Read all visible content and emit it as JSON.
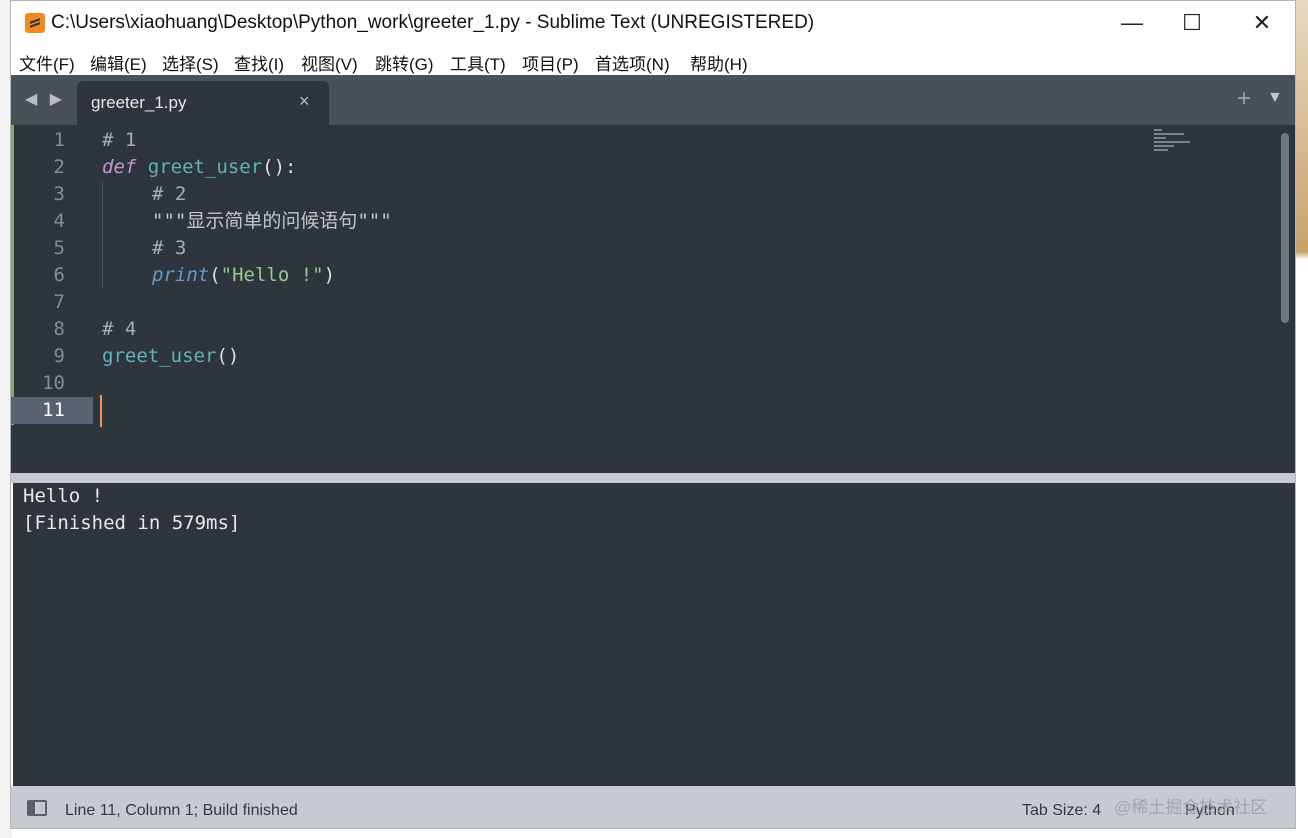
{
  "window": {
    "title": "C:\\Users\\xiaohuang\\Desktop\\Python_work\\greeter_1.py - Sublime Text (UNREGISTERED)",
    "controls": {
      "minimize": "—",
      "maximize": "☐",
      "close": "✕"
    }
  },
  "menu": [
    "文件(F)",
    "编辑(E)",
    "选择(S)",
    "查找(I)",
    "视图(V)",
    "跳转(G)",
    "工具(T)",
    "项目(P)",
    "首选项(N)",
    "帮助(H)"
  ],
  "tabs": {
    "nav": "◀ ▶",
    "active": {
      "label": "greeter_1.py",
      "close": "×"
    },
    "new_tab": "+",
    "menu": "▼"
  },
  "editor": {
    "line_numbers": [
      "1",
      "2",
      "3",
      "4",
      "5",
      "6",
      "7",
      "8",
      "9",
      "10",
      "11"
    ],
    "current_line": 11,
    "code": {
      "l1": "# 1",
      "l2_kw": "def",
      "l2_fn": "greet_user",
      "l2_rest": "():",
      "l3": "# 2",
      "l4": "\"\"\"显示简单的问候语句\"\"\"",
      "l5": "# 3",
      "l6_fn": "print",
      "l6_open": "(",
      "l6_str": "\"Hello !\"",
      "l6_close": ")",
      "l8": "# 4",
      "l9_fn": "greet_user",
      "l9_rest": "()"
    }
  },
  "output": {
    "lines": [
      "Hello !",
      "[Finished in 579ms]"
    ]
  },
  "status": {
    "position": "Line 11, Column 1; Build finished",
    "tab_size": "Tab Size: 4",
    "syntax": "Python"
  },
  "watermark": "@稀土掘金技术社区",
  "colors": {
    "editor_bg": "#2f353d",
    "keyword": "#c594c5",
    "function": "#5fb4b4",
    "string": "#99c794",
    "builtin": "#6699cc",
    "cursor": "#f99157"
  }
}
